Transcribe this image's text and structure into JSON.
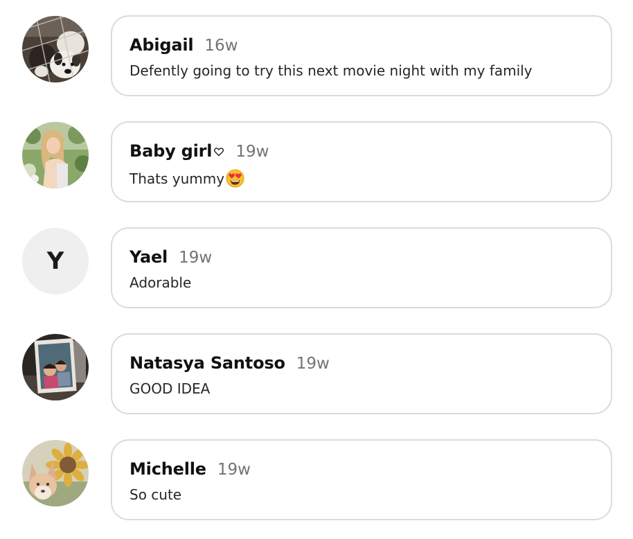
{
  "comments": [
    {
      "author": "Abigail",
      "time": "16w",
      "text": "Defently going to try this next movie night with my family",
      "avatar_icon": "dog-photo-avatar"
    },
    {
      "author": "Baby girl",
      "author_suffix_icon": "heart-outline-icon",
      "time": "19w",
      "text": "Thats yummy",
      "text_suffix_icon": "heart-eyes-emoji-icon",
      "avatar_icon": "portrait-photo-avatar"
    },
    {
      "author": "Yael",
      "time": "19w",
      "text": "Adorable",
      "avatar_letter": "Y"
    },
    {
      "author": "Natasya Santoso",
      "time": "19w",
      "text": "GOOD IDEA",
      "avatar_icon": "family-photo-avatar"
    },
    {
      "author": "Michelle",
      "time": "19w",
      "text": "So cute",
      "avatar_icon": "fox-sunflower-avatar"
    }
  ],
  "colors": {
    "bubble_border": "#dbdbdb",
    "timestamp": "#737373",
    "avatar_placeholder_bg": "#efefef"
  }
}
